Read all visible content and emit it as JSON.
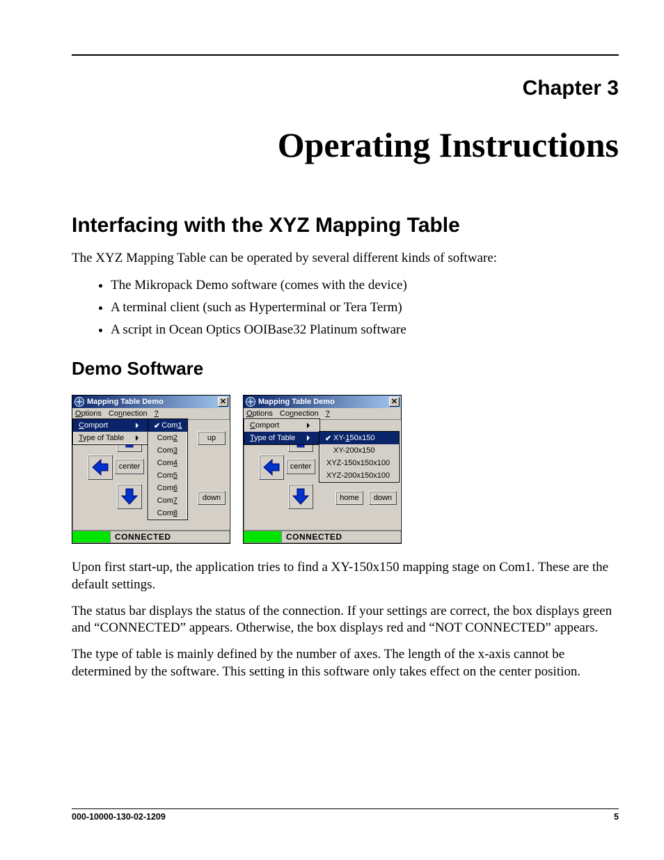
{
  "chapter_label": "Chapter 3",
  "chapter_title": "Operating Instructions",
  "h2_interfacing": "Interfacing with the XYZ Mapping Table",
  "intro_para": "The XYZ Mapping Table can be operated by several different kinds of software:",
  "bullets": [
    "The Mikropack Demo software (comes with the device)",
    "A terminal client (such as Hyperterminal or Tera Term)",
    "A script in Ocean Optics OOIBase32 Platinum software"
  ],
  "h3_demo": "Demo Software",
  "window": {
    "title": "Mapping Table Demo",
    "menu": {
      "options": "Options",
      "connection": "Connection",
      "help": "?"
    },
    "submenu": {
      "comport": "Comport",
      "type_of_table": "Type of Table"
    },
    "comport_items": [
      "Com1",
      "Com2",
      "Com3",
      "Com4",
      "Com5",
      "Com6",
      "Com7",
      "Com8"
    ],
    "table_items": [
      "XY-150x150",
      "XY-200x150",
      "XYZ-150x150x100",
      "XYZ-200x150x100"
    ],
    "buttons": {
      "up": "up",
      "down": "down",
      "center": "center",
      "home": "home"
    },
    "status": "CONNECTED"
  },
  "para_startup": "Upon first start-up, the application tries to find a XY-150x150 mapping stage on Com1. These are the default settings.",
  "para_status": "The status bar displays the status of the connection. If your settings are correct, the box displays green and “CONNECTED” appears. Otherwise, the box displays red and “NOT CONNECTED” appears.",
  "para_type": "The type of table is mainly defined by the number of axes. The length of the x-axis cannot be determined by the software. This setting in this software only takes effect on the center position.",
  "footer": {
    "docnum": "000-10000-130-02-1209",
    "page": "5"
  }
}
